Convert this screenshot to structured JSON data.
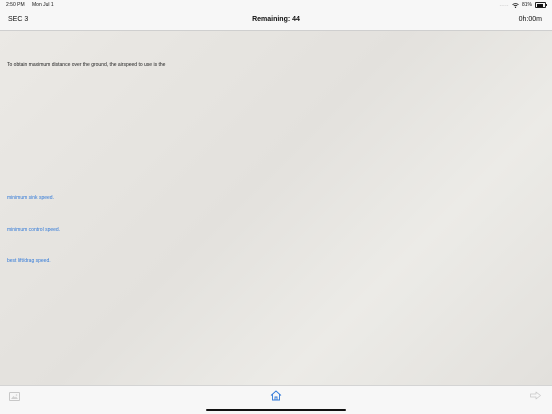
{
  "status_bar": {
    "time": "2:50 PM",
    "date": "Mon Jul 1",
    "battery": "81%",
    "battery_level": 0.81,
    "signal": "....."
  },
  "nav": {
    "section": "SEC 3",
    "remaining": "Remaining: 44",
    "timer": "0h:00m"
  },
  "question": {
    "text": "To obtain maximum distance over the ground, the airspeed to use is the"
  },
  "answers": [
    {
      "text": "minimum sink speed."
    },
    {
      "text": "minimum control speed."
    },
    {
      "text": "best lift/drag speed."
    }
  ],
  "colors": {
    "answer": "#2f78d8",
    "home_icon": "#2f78d8",
    "disabled_icon": "#c8c8c8"
  },
  "icons": {
    "left": "image-icon",
    "center": "home-icon",
    "right": "next-arrow-icon"
  }
}
